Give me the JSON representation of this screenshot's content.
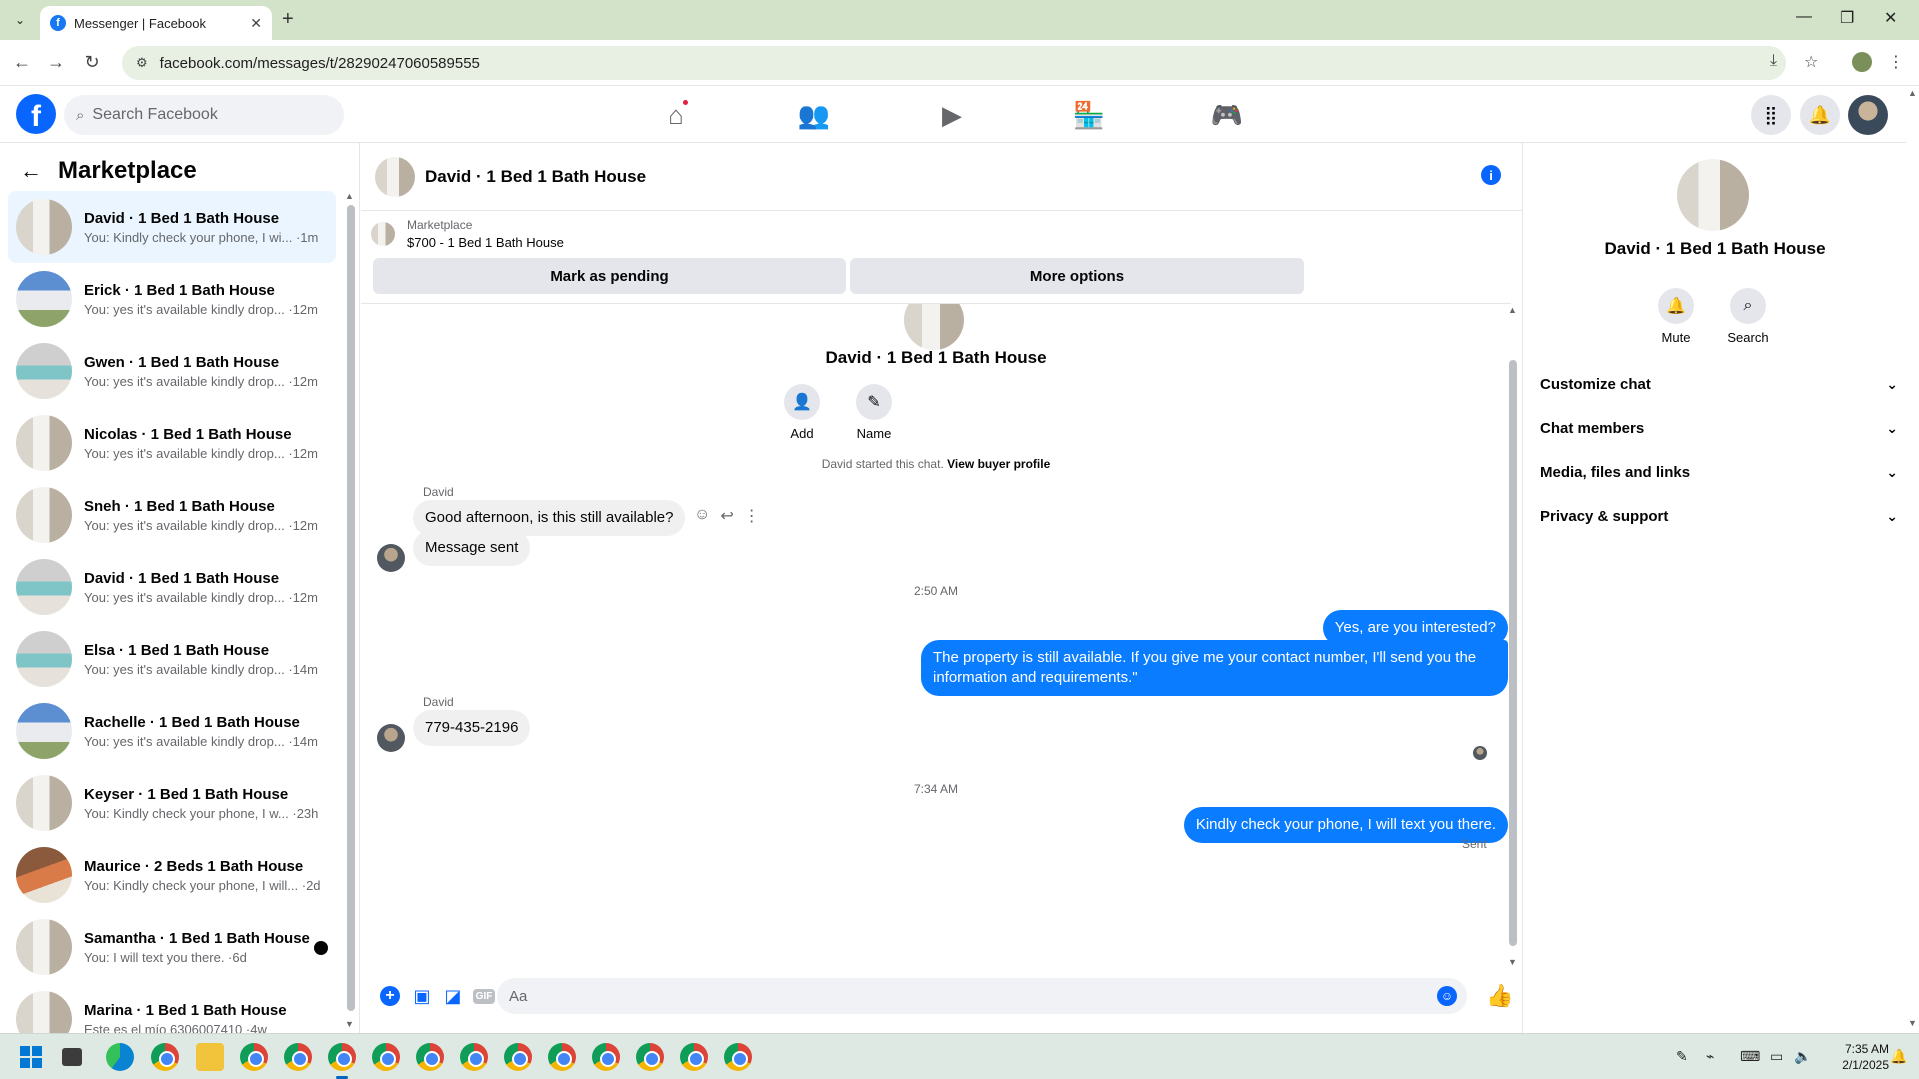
{
  "browser": {
    "tab_title": "Messenger | Facebook",
    "url": "facebook.com/messages/t/28290247060589555"
  },
  "fbnav": {
    "search_placeholder": "Search Facebook"
  },
  "sidebar": {
    "title": "Marketplace",
    "conversations": [
      {
        "name": "David · 1 Bed 1 Bath House",
        "preview": "You: Kindly check your phone, I wi... ·1m",
        "active": true
      },
      {
        "name": "Erick · 1 Bed 1 Bath House",
        "preview": "You: yes it's available kindly drop... ·12m"
      },
      {
        "name": "Gwen · 1 Bed 1 Bath House",
        "preview": "You: yes it's available kindly drop... ·12m"
      },
      {
        "name": "Nicolas · 1 Bed 1 Bath House",
        "preview": "You: yes it's available kindly drop... ·12m"
      },
      {
        "name": "Sneh · 1 Bed 1 Bath House",
        "preview": "You: yes it's available kindly drop... ·12m"
      },
      {
        "name": "David · 1 Bed 1 Bath House",
        "preview": "You: yes it's available kindly drop... ·12m"
      },
      {
        "name": "Elsa · 1 Bed 1 Bath House",
        "preview": "You: yes it's available kindly drop... ·14m"
      },
      {
        "name": "Rachelle · 1 Bed 1 Bath House",
        "preview": "You: yes it's available kindly drop... ·14m"
      },
      {
        "name": "Keyser · 1 Bed 1 Bath House",
        "preview": "You: Kindly check your phone, I w... ·23h"
      },
      {
        "name": "Maurice · 2 Beds 1 Bath House",
        "preview": "You: Kindly check your phone, I will... ·2d"
      },
      {
        "name": "Samantha · 1 Bed 1 Bath House",
        "preview": "You: I will text you there. ·6d",
        "unread": true
      },
      {
        "name": "Marina · 1 Bed 1 Bath House",
        "preview": "Este es el mío 6306007410 ·4w"
      }
    ]
  },
  "chat": {
    "header_name": "David · 1 Bed 1 Bath House",
    "marketplace_label": "Marketplace",
    "listing": "$700 - 1 Bed 1 Bath House",
    "mark_pending": "Mark as pending",
    "more_options": "More options",
    "group_name": "David · 1 Bed 1 Bath House",
    "add_label": "Add",
    "name_label": "Name",
    "started_text": "David started this chat.",
    "view_buyer": "View buyer profile",
    "sender": "David",
    "msg1": "Good afternoon, is this still available?",
    "msg2": "Message sent",
    "time1": "2:50 AM",
    "out1": "Yes, are you interested?",
    "out2_line1": "The property is still available. If you give me your contact number, I'll send you the",
    "out2_line2": "information and requirements.\"",
    "sender2": "David",
    "msg3": "779-435-2196",
    "time2": "7:34 AM",
    "out3": "Kindly check your phone, I will text you there.",
    "sent_status": "Sent",
    "composer_placeholder": "Aa"
  },
  "rpanel": {
    "name": "David · 1 Bed 1 Bath House",
    "mute": "Mute",
    "search": "Search",
    "sections": [
      "Customize chat",
      "Chat members",
      "Media, files and links",
      "Privacy & support"
    ]
  },
  "taskbar": {
    "time": "7:35 AM",
    "date": "2/1/2025"
  },
  "colors": {
    "fb_blue": "#0866ff",
    "bubble_out": "#0a7cff",
    "active_row": "#ebf5ff"
  }
}
